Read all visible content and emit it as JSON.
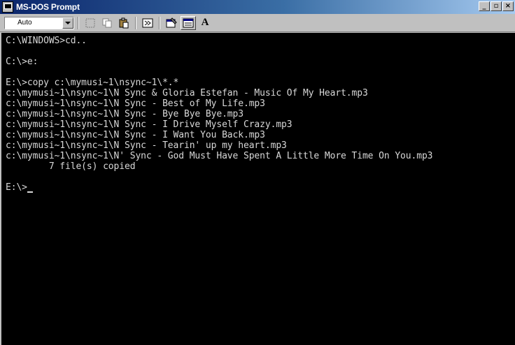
{
  "window": {
    "title": "MS-DOS Prompt",
    "controls": {
      "minimize": "_",
      "maximize": "▫",
      "close": "×"
    }
  },
  "toolbar": {
    "font_size_value": "Auto",
    "buttons": [
      {
        "name": "mark-icon"
      },
      {
        "name": "copy-icon"
      },
      {
        "name": "paste-icon"
      },
      {
        "name": "fullscreen-icon"
      },
      {
        "name": "properties-icon"
      },
      {
        "name": "background-icon"
      },
      {
        "name": "font-icon",
        "label": "A"
      }
    ]
  },
  "console": {
    "lines": [
      "C:\\WINDOWS>cd..",
      "",
      "C:\\>e:",
      "",
      "E:\\>copy c:\\mymusi~1\\nsync~1\\*.*",
      "c:\\mymusi~1\\nsync~1\\N Sync & Gloria Estefan - Music Of My Heart.mp3",
      "c:\\mymusi~1\\nsync~1\\N Sync - Best of My Life.mp3",
      "c:\\mymusi~1\\nsync~1\\N Sync - Bye Bye Bye.mp3",
      "c:\\mymusi~1\\nsync~1\\N Sync - I Drive Myself Crazy.mp3",
      "c:\\mymusi~1\\nsync~1\\N Sync - I Want You Back.mp3",
      "c:\\mymusi~1\\nsync~1\\N Sync - Tearin' up my heart.mp3",
      "c:\\mymusi~1\\nsync~1\\N' Sync - God Must Have Spent A Little More Time On You.mp3",
      "        7 file(s) copied",
      "",
      "E:\\>"
    ]
  },
  "colors": {
    "titlebar_start": "#0a246a",
    "console_bg": "#000000",
    "console_fg": "#d8d8d8"
  }
}
